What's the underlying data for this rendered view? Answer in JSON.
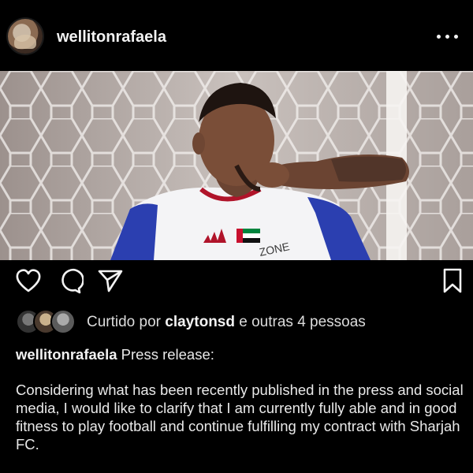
{
  "header": {
    "username": "wellitonrafaela",
    "avatar_icon": "profile-avatar",
    "more_icon": "more-options-icon"
  },
  "post": {
    "image_alt_icon": "post-photo"
  },
  "actions": {
    "like_icon": "heart-icon",
    "comment_icon": "comment-icon",
    "share_icon": "send-icon",
    "save_icon": "bookmark-icon"
  },
  "likes": {
    "prefix": "Curtido por",
    "user": "claytonsd",
    "suffix": "e outras 4 pessoas"
  },
  "caption": {
    "username": "wellitonrafaela",
    "title": "Press release:",
    "body": "Considering what has been recently published in the press and social media, I would like to clarify that I am currently fully able and in good fitness to play football and continue fulfilling my contract with Sharjah FC."
  },
  "colors": {
    "background": "#000000",
    "text": "#f2f2f2"
  }
}
